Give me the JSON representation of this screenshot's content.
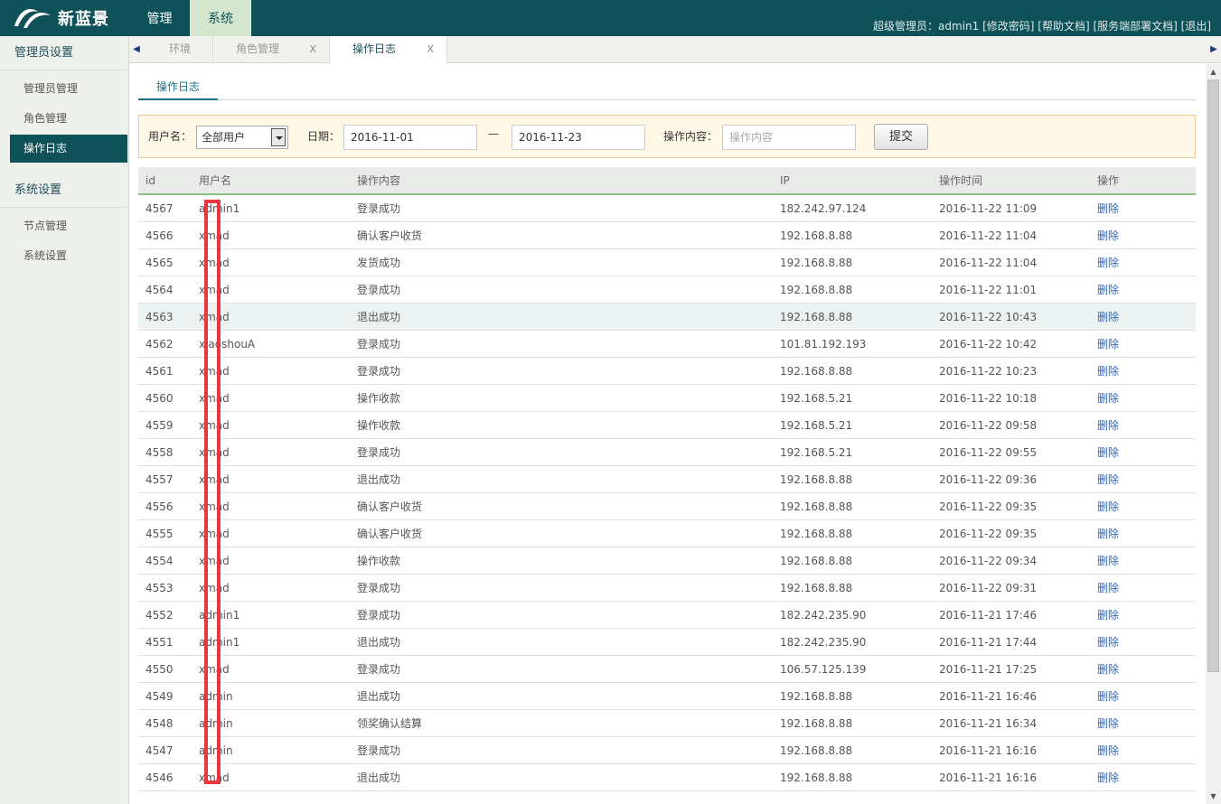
{
  "app": {
    "logo_text": "新蓝景",
    "nav_tabs": [
      "管理",
      "系统"
    ],
    "user_info": "超级管理员：admin1 [修改密码] [帮助文档] [服务端部署文档] [退出]"
  },
  "sidebar": {
    "group1": "管理员设置",
    "group1_items": [
      "管理员管理",
      "角色管理",
      "操作日志"
    ],
    "group2": "系统设置",
    "group2_items": [
      "节点管理",
      "系统设置"
    ],
    "active_item": "操作日志"
  },
  "page_tabs": [
    {
      "label": "环境",
      "close": ""
    },
    {
      "label": "角色管理",
      "close": "X"
    },
    {
      "label": "操作日志",
      "close": "X"
    }
  ],
  "subtab": "操作日志",
  "filter": {
    "user_label": "用户名：",
    "user_value": "全部用户",
    "date_label": "日期：",
    "date_from": "2016-11-01",
    "date_sep": "—",
    "date_to": "2016-11-23",
    "content_label": "操作内容：",
    "content_placeholder": "操作内容",
    "submit": "提交"
  },
  "table": {
    "headers": [
      "id",
      "用户名",
      "操作内容",
      "IP",
      "操作时间",
      "操作"
    ],
    "rows": [
      {
        "id": "4567",
        "user": "admin1",
        "op": "登录成功",
        "ip": "182.242.97.124",
        "time": "2016-11-22 11:09",
        "act": "删除"
      },
      {
        "id": "4566",
        "user": "xmad",
        "op": "确认客户收货",
        "ip": "192.168.8.88",
        "time": "2016-11-22 11:04",
        "act": "删除"
      },
      {
        "id": "4565",
        "user": "xmad",
        "op": "发货成功",
        "ip": "192.168.8.88",
        "time": "2016-11-22 11:04",
        "act": "删除"
      },
      {
        "id": "4564",
        "user": "xmad",
        "op": "登录成功",
        "ip": "192.168.8.88",
        "time": "2016-11-22 11:01",
        "act": "删除"
      },
      {
        "id": "4563",
        "user": "xmad",
        "op": "退出成功",
        "ip": "192.168.8.88",
        "time": "2016-11-22 10:43",
        "act": "删除"
      },
      {
        "id": "4562",
        "user": "xiaoshouA",
        "op": "登录成功",
        "ip": "101.81.192.193",
        "time": "2016-11-22 10:42",
        "act": "删除"
      },
      {
        "id": "4561",
        "user": "xmad",
        "op": "登录成功",
        "ip": "192.168.8.88",
        "time": "2016-11-22 10:23",
        "act": "删除"
      },
      {
        "id": "4560",
        "user": "xmad",
        "op": "操作收款",
        "ip": "192.168.5.21",
        "time": "2016-11-22 10:18",
        "act": "删除"
      },
      {
        "id": "4559",
        "user": "xmad",
        "op": "操作收款",
        "ip": "192.168.5.21",
        "time": "2016-11-22 09:58",
        "act": "删除"
      },
      {
        "id": "4558",
        "user": "xmad",
        "op": "登录成功",
        "ip": "192.168.5.21",
        "time": "2016-11-22 09:55",
        "act": "删除"
      },
      {
        "id": "4557",
        "user": "xmad",
        "op": "退出成功",
        "ip": "192.168.8.88",
        "time": "2016-11-22 09:36",
        "act": "删除"
      },
      {
        "id": "4556",
        "user": "xmad",
        "op": "确认客户收货",
        "ip": "192.168.8.88",
        "time": "2016-11-22 09:35",
        "act": "删除"
      },
      {
        "id": "4555",
        "user": "xmad",
        "op": "确认客户收货",
        "ip": "192.168.8.88",
        "time": "2016-11-22 09:35",
        "act": "删除"
      },
      {
        "id": "4554",
        "user": "xmad",
        "op": "操作收款",
        "ip": "192.168.8.88",
        "time": "2016-11-22 09:34",
        "act": "删除"
      },
      {
        "id": "4553",
        "user": "xmad",
        "op": "登录成功",
        "ip": "192.168.8.88",
        "time": "2016-11-22 09:31",
        "act": "删除"
      },
      {
        "id": "4552",
        "user": "admin1",
        "op": "登录成功",
        "ip": "182.242.235.90",
        "time": "2016-11-21 17:46",
        "act": "删除"
      },
      {
        "id": "4551",
        "user": "admin1",
        "op": "退出成功",
        "ip": "182.242.235.90",
        "time": "2016-11-21 17:44",
        "act": "删除"
      },
      {
        "id": "4550",
        "user": "xmad",
        "op": "登录成功",
        "ip": "106.57.125.139",
        "time": "2016-11-21 17:25",
        "act": "删除"
      },
      {
        "id": "4549",
        "user": "admin",
        "op": "退出成功",
        "ip": "192.168.8.88",
        "time": "2016-11-21 16:46",
        "act": "删除"
      },
      {
        "id": "4548",
        "user": "admin",
        "op": "领奖确认结算",
        "ip": "192.168.8.88",
        "time": "2016-11-21 16:34",
        "act": "删除"
      },
      {
        "id": "4547",
        "user": "admin",
        "op": "登录成功",
        "ip": "192.168.8.88",
        "time": "2016-11-21 16:16",
        "act": "删除"
      },
      {
        "id": "4546",
        "user": "xmad",
        "op": "退出成功",
        "ip": "192.168.8.88",
        "time": "2016-11-21 16:16",
        "act": "删除"
      }
    ],
    "highlighted_row": "4563"
  },
  "colors": {
    "header_bg": "#0e5158",
    "accent_link": "#2a67c2",
    "red_mark": "#e8383d",
    "filter_bg": "#fff8e7"
  }
}
